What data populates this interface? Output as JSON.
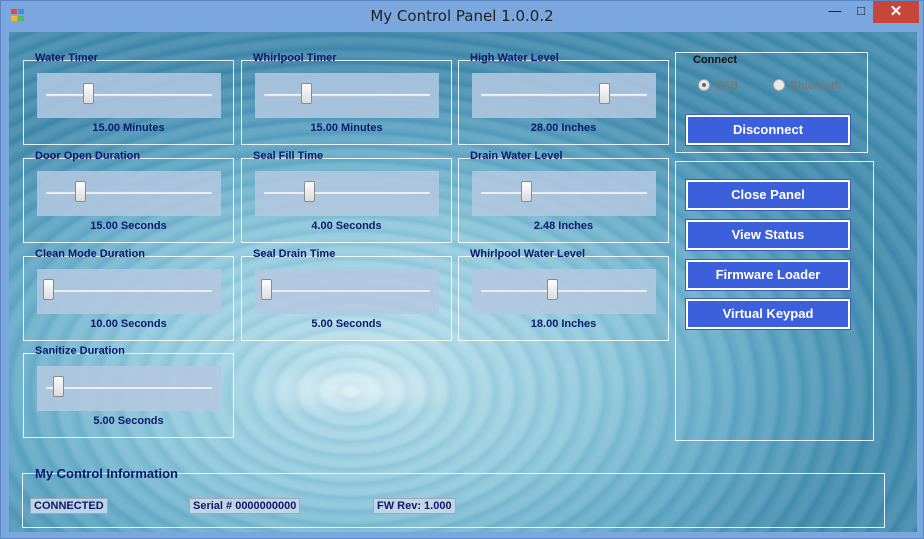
{
  "window": {
    "title": "My Control Panel 1.0.0.2",
    "min_glyph": "—",
    "max_glyph": "□",
    "close_glyph": "✕"
  },
  "sliders": [
    {
      "label": "Water Timer",
      "value": "15.00 Minutes",
      "level": 0.25
    },
    {
      "label": "Whirlpool Timer",
      "value": "15.00 Minutes",
      "level": 0.25
    },
    {
      "label": "High Water Level",
      "value": "28.00 Inches",
      "level": 0.75
    },
    {
      "label": "Door Open Duration",
      "value": "15.00 Seconds",
      "level": 0.2
    },
    {
      "label": "Seal Fill Time",
      "value": "4.00 Seconds",
      "level": 0.27
    },
    {
      "label": "Drain Water Level",
      "value": "2.48 Inches",
      "level": 0.27
    },
    {
      "label": "Clean Mode Duration",
      "value": "10.00 Seconds",
      "level": 0.0
    },
    {
      "label": "Seal Drain Time",
      "value": "5.00 Seconds",
      "level": 0.0
    },
    {
      "label": "Whirlpool Water Level",
      "value": "18.00 Inches",
      "level": 0.43
    },
    {
      "label": "Sanitize Duration",
      "value": "5.00 Seconds",
      "level": 0.06
    }
  ],
  "connect": {
    "label": "Connect",
    "options": [
      {
        "label": "USB",
        "selected": true
      },
      {
        "label": "Bluetooth",
        "selected": false
      }
    ],
    "disconnect_label": "Disconnect"
  },
  "actions": {
    "close_panel": "Close Panel",
    "view_status": "View Status",
    "firmware_loader": "Firmware Loader",
    "virtual_keypad": "Virtual Keypad"
  },
  "info": {
    "title": "My Control Information",
    "status": "CONNECTED",
    "serial": "Serial # 0000000000",
    "fw_rev": "FW Rev: 1.000"
  },
  "colors": {
    "button": "#3c5fdb",
    "label_text": "#0c1a6e"
  }
}
